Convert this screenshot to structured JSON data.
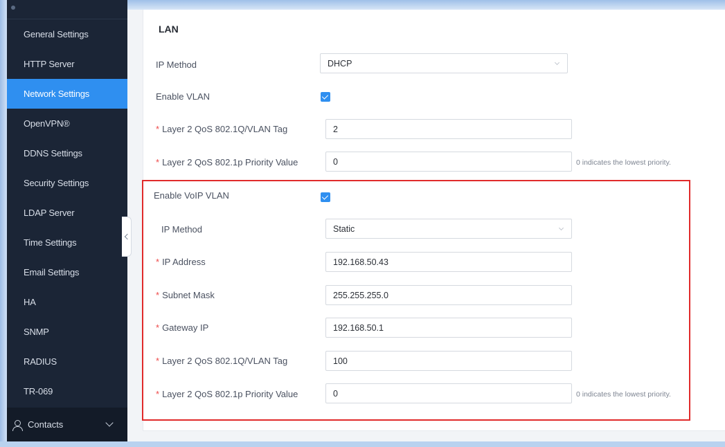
{
  "sidebar": {
    "items": [
      {
        "label": "General Settings",
        "active": false
      },
      {
        "label": "HTTP Server",
        "active": false
      },
      {
        "label": "Network Settings",
        "active": true
      },
      {
        "label": "OpenVPN®",
        "active": false
      },
      {
        "label": "DDNS Settings",
        "active": false
      },
      {
        "label": "Security Settings",
        "active": false
      },
      {
        "label": "LDAP Server",
        "active": false
      },
      {
        "label": "Time Settings",
        "active": false
      },
      {
        "label": "Email Settings",
        "active": false
      },
      {
        "label": "HA",
        "active": false
      },
      {
        "label": "SNMP",
        "active": false
      },
      {
        "label": "RADIUS",
        "active": false
      },
      {
        "label": "TR-069",
        "active": false
      }
    ],
    "group": {
      "label": "Contacts",
      "icon": "contacts-person-icon",
      "expand_icon": "chevron-down-icon"
    }
  },
  "lan": {
    "title": "LAN",
    "ip_method": {
      "label": "IP Method",
      "value": "DHCP"
    },
    "enable_vlan": {
      "label": "Enable VLAN",
      "checked": true
    },
    "vlan_tag": {
      "required": "*",
      "label": "Layer 2 QoS 802.1Q/VLAN Tag",
      "value": "2"
    },
    "priority": {
      "required": "*",
      "label": "Layer 2 QoS 802.1p Priority Value",
      "value": "0",
      "hint": "0 indicates the lowest priority."
    }
  },
  "voip": {
    "enable_voip_vlan": {
      "label": "Enable VoIP VLAN",
      "checked": true
    },
    "ip_method": {
      "label": "IP Method",
      "value": "Static"
    },
    "ip_address": {
      "required": "*",
      "label": "IP Address",
      "value": "192.168.50.43"
    },
    "subnet_mask": {
      "required": "*",
      "label": "Subnet Mask",
      "value": "255.255.255.0"
    },
    "gateway_ip": {
      "required": "*",
      "label": "Gateway IP",
      "value": "192.168.50.1"
    },
    "vlan_tag": {
      "required": "*",
      "label": "Layer 2 QoS 802.1Q/VLAN Tag",
      "value": "100"
    },
    "priority": {
      "required": "*",
      "label": "Layer 2 QoS 802.1p Priority Value",
      "value": "0",
      "hint": "0 indicates the lowest priority."
    }
  },
  "colors": {
    "accent": "#2f8ff0",
    "sidebar_bg": "#1b2536",
    "highlight": "#e02a2a",
    "required": "#ee4a4a"
  }
}
